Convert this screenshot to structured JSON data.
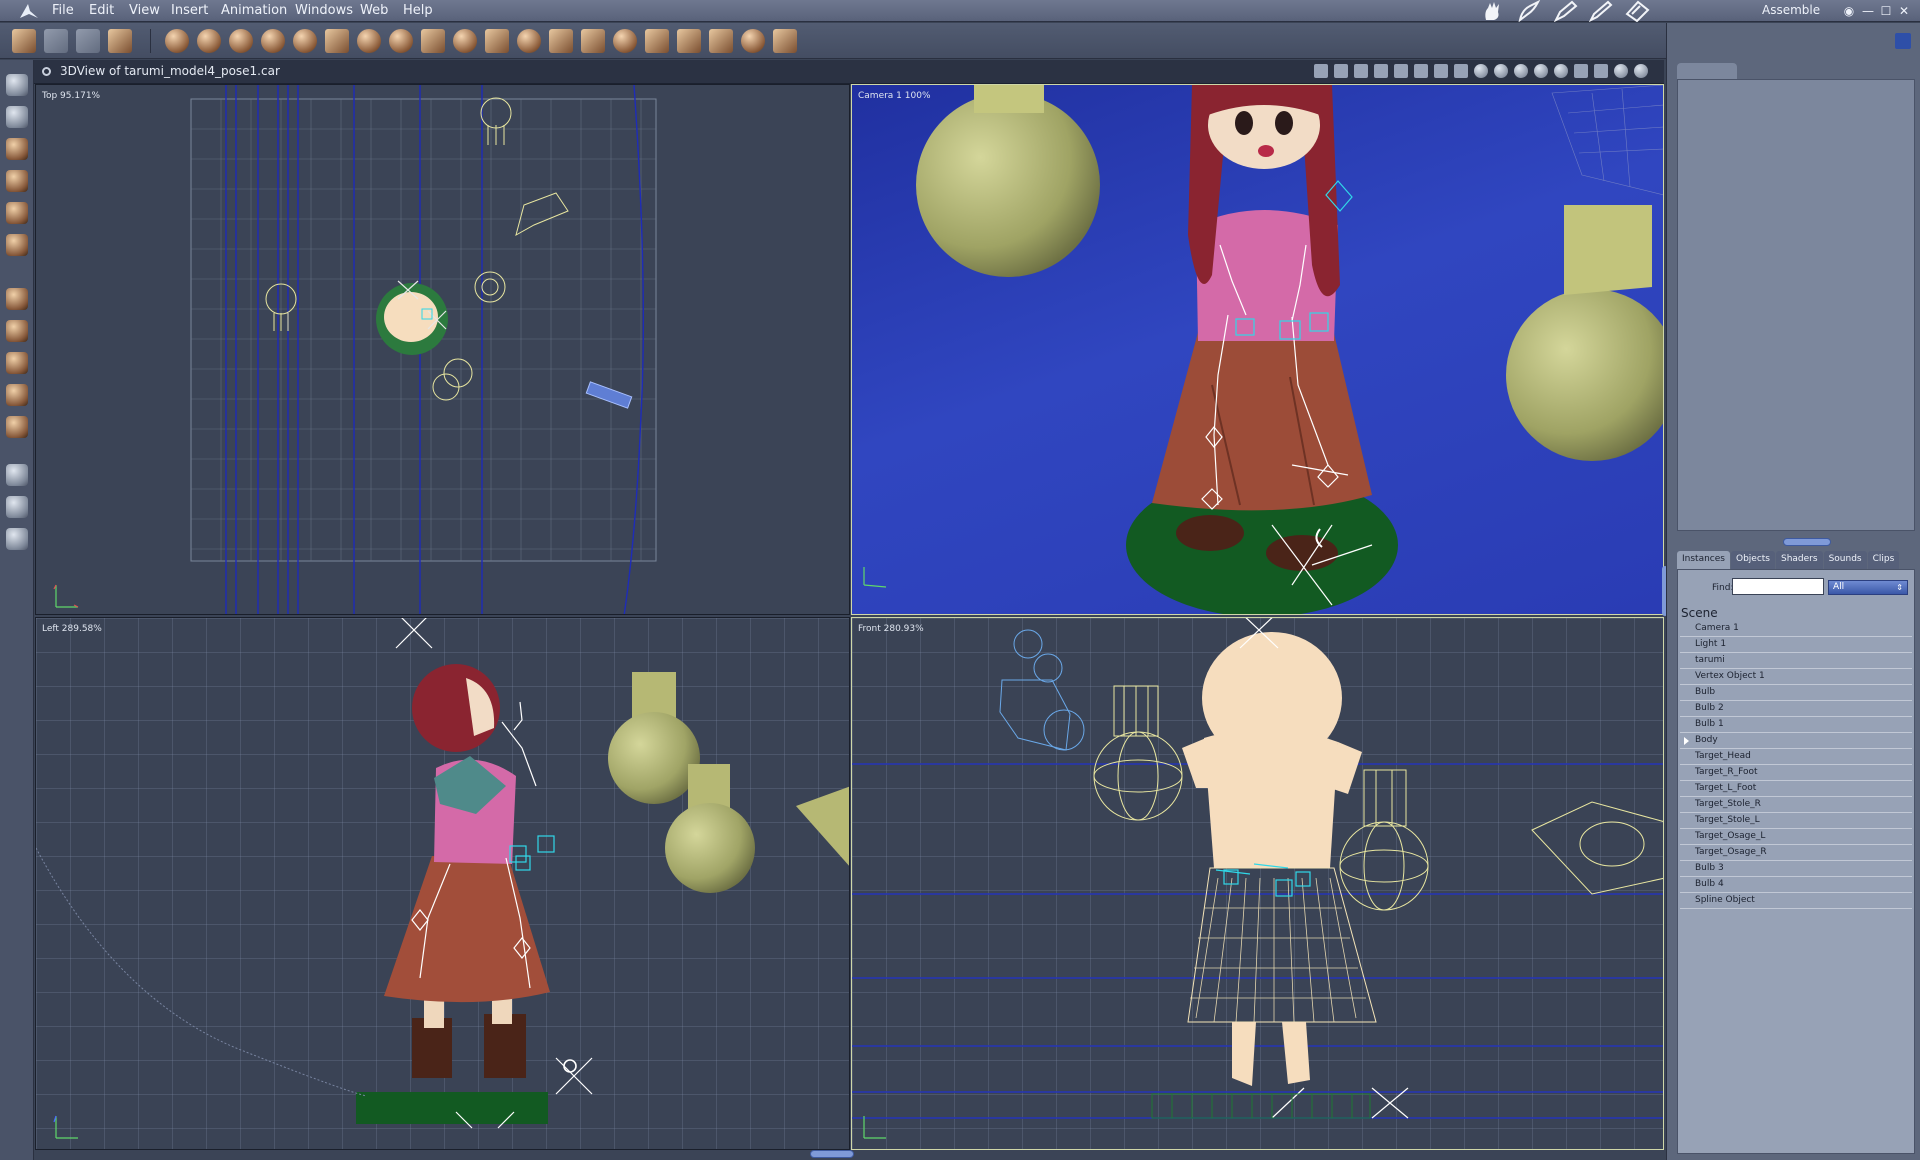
{
  "menubar": {
    "items": [
      "File",
      "Edit",
      "View",
      "Insert",
      "Animation",
      "Windows",
      "Web",
      "Help"
    ],
    "room_name": "Assemble",
    "room_icons": [
      "hand-room-icon",
      "brush-room-icon",
      "pen-room-icon",
      "pencil-room-icon",
      "render-room-icon"
    ]
  },
  "toolbar": {
    "tools": [
      "brush-tool",
      "hand-tool",
      "feather-tool",
      "wand-tool",
      "sphere-primitive",
      "cylinder-primitive",
      "grid-sphere-primitive",
      "cone-primitive",
      "torus-primitive",
      "text-primitive",
      "ring-primitive",
      "gear-primitive",
      "plane-primitive",
      "tree-primitive",
      "hat-primitive",
      "flame-primitive",
      "wave-primitive",
      "terrain-primitive",
      "bowl-primitive",
      "hammer-primitive",
      "skeleton-tool",
      "bone-tool",
      "target-tool",
      "stick-tool"
    ]
  },
  "document": {
    "title": "3DView of tarumi_model4_pose1.car"
  },
  "viewports": {
    "top": {
      "label": "Top 95.171%"
    },
    "camera": {
      "label": "Camera 1  100%"
    },
    "left": {
      "label": "Left 289.58%"
    },
    "front": {
      "label": "Front 280.93%"
    }
  },
  "browser": {
    "tabs": [
      "Instances",
      "Objects",
      "Shaders",
      "Sounds",
      "Clips"
    ],
    "active_tab": "Instances",
    "find_label": "Find:",
    "find_value": "",
    "filter_value": "All",
    "scene_header": "Scene",
    "items": [
      "Camera 1",
      "Light 1",
      "tarumi",
      "Vertex Object 1",
      "Bulb",
      "Bulb 2",
      "Bulb 1",
      "Body",
      "Target_Head",
      "Target_R_Foot",
      "Target_L_Foot",
      "Target_Stole_R",
      "Target_Stole_L",
      "Target_Osage_L",
      "Target_Osage_R",
      "Bulb 3",
      "Bulb 4",
      "Spline Object"
    ],
    "expandable_item": "Body"
  },
  "colors": {
    "background": "#3b4456",
    "camera_bg": "#2a3cb4",
    "accent": "#7f9ad8",
    "skirt": "#a24e3a",
    "sweater": "#d86aa8",
    "hair": "#8c2430",
    "bulb": "#b8bb76",
    "ground": "#1a6a2a",
    "wire_yellow": "#e8e6a0",
    "wire_cyan": "#30d8e8"
  }
}
